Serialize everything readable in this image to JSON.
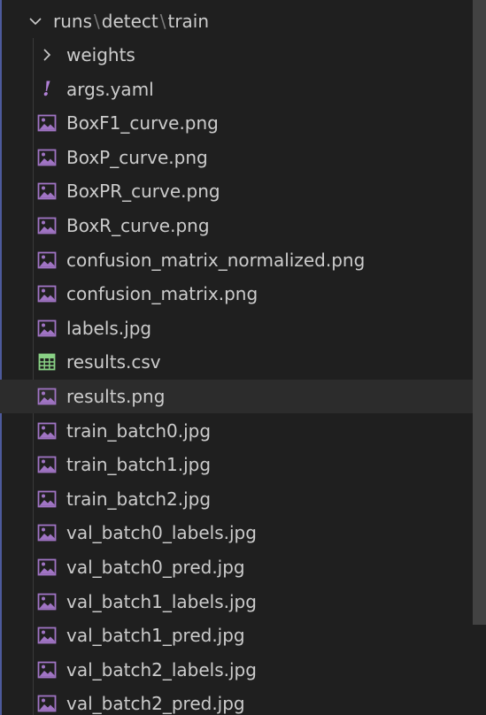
{
  "explorer": {
    "root": {
      "segments": [
        "runs",
        "detect",
        "train"
      ],
      "separator": "\\"
    },
    "items": [
      {
        "label": "weights",
        "kind": "folder"
      },
      {
        "label": "args.yaml",
        "kind": "yaml"
      },
      {
        "label": "BoxF1_curve.png",
        "kind": "image"
      },
      {
        "label": "BoxP_curve.png",
        "kind": "image"
      },
      {
        "label": "BoxPR_curve.png",
        "kind": "image"
      },
      {
        "label": "BoxR_curve.png",
        "kind": "image"
      },
      {
        "label": "confusion_matrix_normalized.png",
        "kind": "image"
      },
      {
        "label": "confusion_matrix.png",
        "kind": "image"
      },
      {
        "label": "labels.jpg",
        "kind": "image"
      },
      {
        "label": "results.csv",
        "kind": "csv"
      },
      {
        "label": "results.png",
        "kind": "image",
        "selected": true
      },
      {
        "label": "train_batch0.jpg",
        "kind": "image"
      },
      {
        "label": "train_batch1.jpg",
        "kind": "image"
      },
      {
        "label": "train_batch2.jpg",
        "kind": "image"
      },
      {
        "label": "val_batch0_labels.jpg",
        "kind": "image"
      },
      {
        "label": "val_batch0_pred.jpg",
        "kind": "image"
      },
      {
        "label": "val_batch1_labels.jpg",
        "kind": "image"
      },
      {
        "label": "val_batch1_pred.jpg",
        "kind": "image"
      },
      {
        "label": "val_batch2_labels.jpg",
        "kind": "image"
      },
      {
        "label": "val_batch2_pred.jpg",
        "kind": "image"
      }
    ],
    "colors": {
      "background": "#1f1f1f",
      "text": "#cccccc",
      "image_icon": "#a074c4",
      "csv_icon": "#89d185",
      "yaml_icon": "#b180d7",
      "selected_row": "#2c2c2c"
    }
  }
}
